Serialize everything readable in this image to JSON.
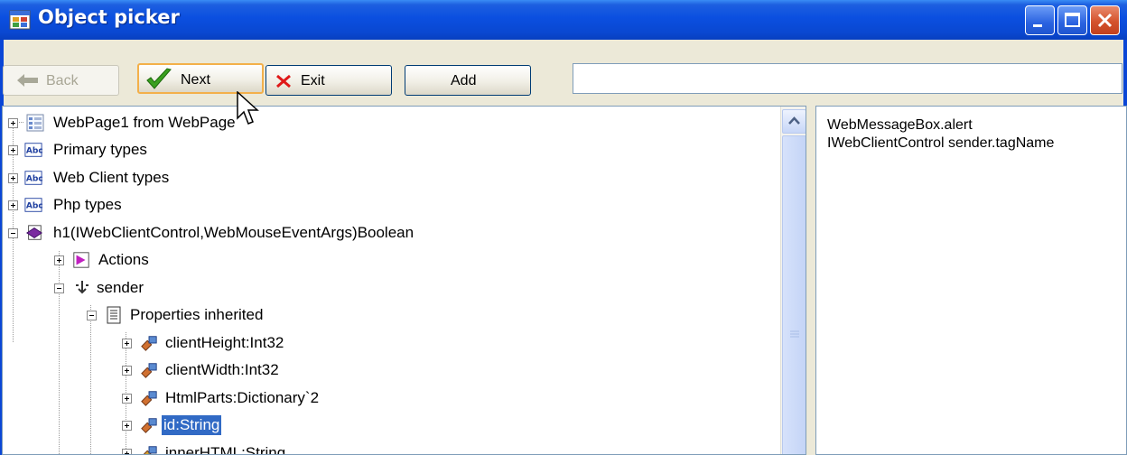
{
  "window": {
    "title": "Object picker"
  },
  "toolbar": {
    "back_label": "Back",
    "next_label": "Next",
    "exit_label": "Exit",
    "add_label": "Add",
    "path_value": ""
  },
  "tree": {
    "items": [
      {
        "label": "WebPage1 from WebPage",
        "icon": "webpage-icon",
        "expander": "plus"
      },
      {
        "label": "Primary types",
        "icon": "abc-type-icon",
        "expander": "plus"
      },
      {
        "label": "Web Client types",
        "icon": "abc-type-icon",
        "expander": "plus"
      },
      {
        "label": "Php types",
        "icon": "abc-type-icon",
        "expander": "plus"
      },
      {
        "label": "h1(IWebClientControl,WebMouseEventArgs)Boolean",
        "icon": "method-icon",
        "expander": "minus"
      },
      {
        "label": "Actions",
        "icon": "actions-icon",
        "expander": "plus"
      },
      {
        "label": "sender",
        "icon": "parameter-icon",
        "expander": "minus"
      },
      {
        "label": "Properties inherited",
        "icon": "properties-icon",
        "expander": "minus"
      },
      {
        "label": "clientHeight:Int32",
        "icon": "property-icon",
        "expander": "plus"
      },
      {
        "label": "clientWidth:Int32",
        "icon": "property-icon",
        "expander": "plus"
      },
      {
        "label": "HtmlParts:Dictionary`2",
        "icon": "property-icon",
        "expander": "plus"
      },
      {
        "label": "id:String",
        "icon": "property-icon",
        "expander": "plus",
        "selected": true
      },
      {
        "label": "innerHTML:String",
        "icon": "property-icon",
        "expander": "plus"
      }
    ]
  },
  "side_panel": {
    "lines": [
      "WebMessageBox.alert",
      "IWebClientControl sender.tagName"
    ]
  },
  "colors": {
    "titlebar": "#0a4fe0",
    "selection": "#316ac5",
    "next_focus": "#f3b04a"
  }
}
